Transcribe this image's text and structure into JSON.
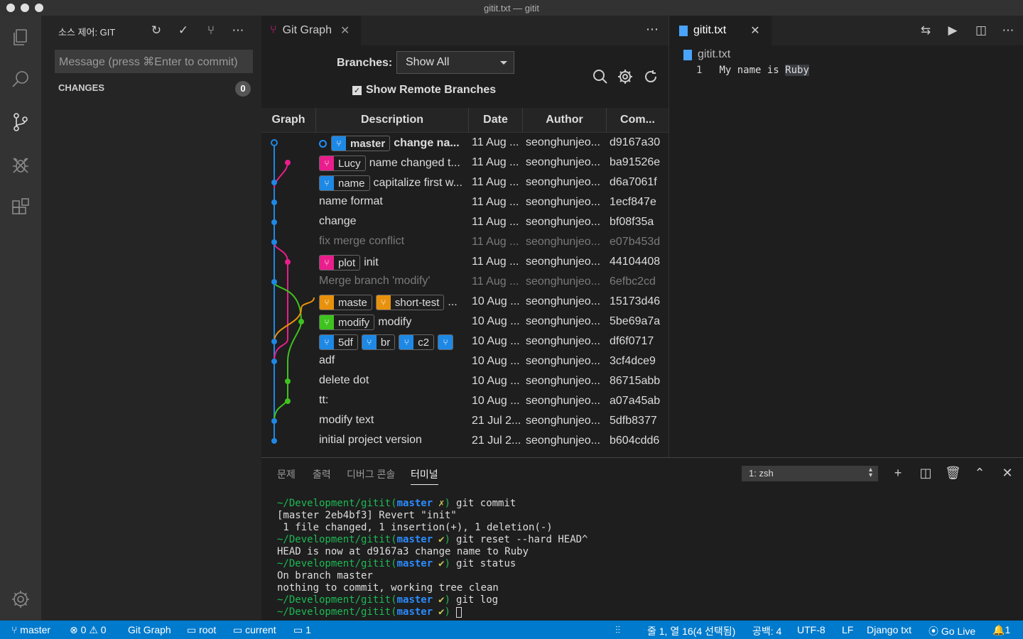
{
  "window": {
    "title": "gitit.txt — gitit"
  },
  "activity_bar": {
    "items": [
      "explorer-icon",
      "search-icon",
      "source-control-icon",
      "debug-icon",
      "extensions-icon"
    ],
    "bottom": "settings-gear-icon"
  },
  "sidebar": {
    "title": "소스 제어: GIT",
    "commit_placeholder": "Message (press ⌘Enter to commit)",
    "changes_label": "CHANGES",
    "changes_count": "0"
  },
  "git_graph": {
    "tab_title": "Git Graph",
    "branches_label": "Branches:",
    "branches_value": "Show All",
    "show_remote_label": "Show Remote Branches",
    "columns": {
      "graph": "Graph",
      "description": "Description",
      "date": "Date",
      "author": "Author",
      "commit": "Com..."
    },
    "rows": [
      {
        "refs": [
          {
            "name": "master",
            "color": "#1e88e5",
            "head": true
          }
        ],
        "hollow": true,
        "desc": "change na...",
        "date": "11 Aug ...",
        "author": "seonghunjeo...",
        "commit": "d9167a30",
        "dim": false
      },
      {
        "refs": [
          {
            "name": "Lucy",
            "color": "#e91e8c"
          }
        ],
        "desc": "name changed t...",
        "date": "11 Aug ...",
        "author": "seonghunjeo...",
        "commit": "ba91526e",
        "dim": false
      },
      {
        "refs": [
          {
            "name": "name",
            "color": "#1e88e5"
          }
        ],
        "desc": "capitalize first w...",
        "date": "11 Aug ...",
        "author": "seonghunjeo...",
        "commit": "d6a7061f",
        "dim": false
      },
      {
        "refs": [],
        "desc": "name format",
        "date": "11 Aug ...",
        "author": "seonghunjeo...",
        "commit": "1ecf847e",
        "dim": false
      },
      {
        "refs": [],
        "desc": "change",
        "date": "11 Aug ...",
        "author": "seonghunjeo...",
        "commit": "bf08f35a",
        "dim": false
      },
      {
        "refs": [],
        "desc": "fix merge conflict",
        "date": "11 Aug ...",
        "author": "seonghunjeo...",
        "commit": "e07b453d",
        "dim": true
      },
      {
        "refs": [
          {
            "name": "plot",
            "color": "#e91e8c"
          }
        ],
        "desc": "init",
        "date": "11 Aug ...",
        "author": "seonghunjeo...",
        "commit": "44104408",
        "dim": false
      },
      {
        "refs": [],
        "desc": "Merge branch 'modify'",
        "date": "11 Aug ...",
        "author": "seonghunjeo...",
        "commit": "6efbc2cd",
        "dim": true
      },
      {
        "refs": [
          {
            "name": "maste",
            "color": "#e8910c"
          },
          {
            "name": "short-test",
            "color": "#e8910c"
          }
        ],
        "desc": "...",
        "date": "10 Aug ...",
        "author": "seonghunjeo...",
        "commit": "15173d46",
        "dim": false
      },
      {
        "refs": [
          {
            "name": "modify",
            "color": "#3fc21f"
          }
        ],
        "desc": "modify",
        "date": "10 Aug ...",
        "author": "seonghunjeo...",
        "commit": "5be69a7a",
        "dim": false
      },
      {
        "refs": [
          {
            "name": "5df",
            "color": "#1e88e5"
          },
          {
            "name": "br",
            "color": "#1e88e5"
          },
          {
            "name": "c2",
            "color": "#1e88e5"
          },
          {
            "name": "",
            "color": "#1e88e5"
          }
        ],
        "desc": "",
        "date": "10 Aug ...",
        "author": "seonghunjeo...",
        "commit": "df6f0717",
        "dim": false
      },
      {
        "refs": [],
        "desc": "adf",
        "date": "10 Aug ...",
        "author": "seonghunjeo...",
        "commit": "3cf4dce9",
        "dim": false
      },
      {
        "refs": [],
        "desc": "delete dot",
        "date": "10 Aug ...",
        "author": "seonghunjeo...",
        "commit": "86715abb",
        "dim": false
      },
      {
        "refs": [],
        "desc": "tt:",
        "date": "10 Aug ...",
        "author": "seonghunjeo...",
        "commit": "a07a45ab",
        "dim": false
      },
      {
        "refs": [],
        "desc": "modify text",
        "date": "21 Jul 2...",
        "author": "seonghunjeo...",
        "commit": "5dfb8377",
        "dim": false
      },
      {
        "refs": [],
        "desc": "initial project version",
        "date": "21 Jul 2...",
        "author": "seonghunjeo...",
        "commit": "b604cdd6",
        "dim": false
      }
    ],
    "colors": {
      "blue": "#1e88e5",
      "pink": "#e91e8c",
      "green": "#3fc21f",
      "orange": "#e8910c"
    }
  },
  "editor": {
    "tab_title": "gitit.txt",
    "breadcrumb": "gitit.txt",
    "line_number": "1",
    "line_text": "My name is ",
    "line_highlight": "Ruby"
  },
  "panel": {
    "tabs": [
      "문제",
      "출력",
      "디버그 콘솔",
      "터미널"
    ],
    "active_tab": "터미널",
    "terminal_select": "1: zsh",
    "terminal_lines": [
      {
        "path": "~/Development/gitit",
        "branch": "master",
        "mark": "✗",
        "cmd": "git commit"
      },
      {
        "text": "[master 2eb4bf3] Revert \"init\""
      },
      {
        "text": " 1 file changed, 1 insertion(+), 1 deletion(-)"
      },
      {
        "path": "~/Development/gitit",
        "branch": "master",
        "mark": "✔",
        "cmd": "git reset --hard HEAD^"
      },
      {
        "text": "HEAD is now at d9167a3 change name to Ruby"
      },
      {
        "path": "~/Development/gitit",
        "branch": "master",
        "mark": "✔",
        "cmd": "git status"
      },
      {
        "text": "On branch master"
      },
      {
        "text": "nothing to commit, working tree clean"
      },
      {
        "path": "~/Development/gitit",
        "branch": "master",
        "mark": "✔",
        "cmd": "git log"
      },
      {
        "path": "~/Development/gitit",
        "branch": "master",
        "mark": "✔",
        "cmd": "",
        "cursor": true
      }
    ]
  },
  "status_bar": {
    "branch": "master",
    "errors": "0",
    "warnings": "0",
    "git_graph": "Git Graph",
    "root": "root",
    "current": "current",
    "terminals": "1",
    "position": "줄 1, 열 16(4 선택됨)",
    "spaces": "공백: 4",
    "encoding": "UTF-8",
    "eol": "LF",
    "language": "Django txt",
    "go_live": "Go Live",
    "notifications": "1"
  }
}
